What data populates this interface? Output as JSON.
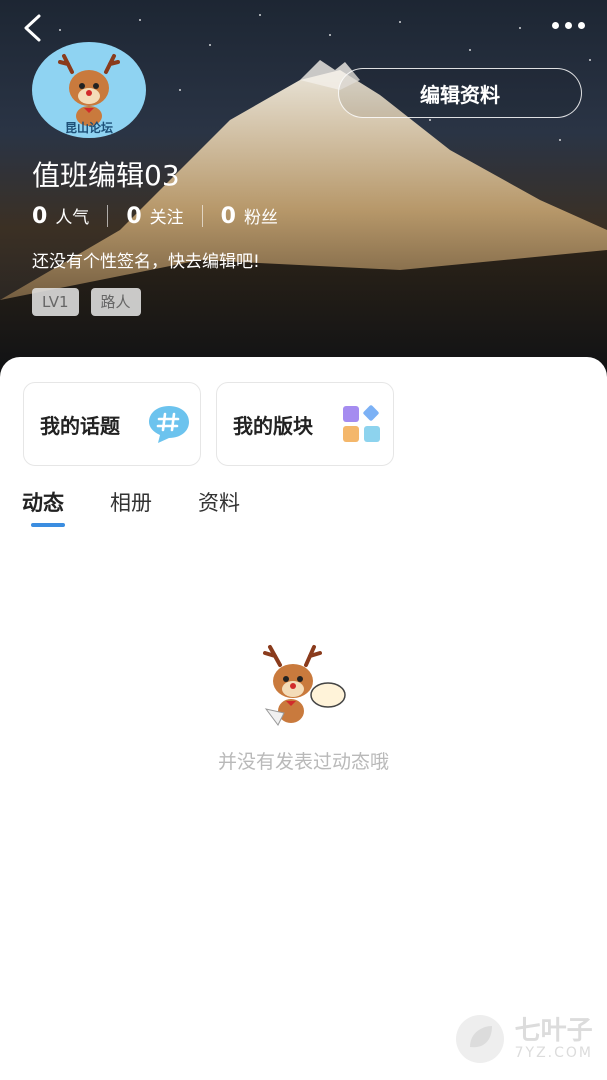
{
  "header": {
    "back_icon": "chevron-left-icon",
    "more_icon": "more-dots-icon"
  },
  "profile": {
    "avatar_caption": "昆山论坛",
    "edit_button_label": "编辑资料",
    "username": "值班编辑03",
    "stats": [
      {
        "value": "0",
        "label": "人气"
      },
      {
        "value": "0",
        "label": "关注"
      },
      {
        "value": "0",
        "label": "粉丝"
      }
    ],
    "signature": "还没有个性签名，快去编辑吧!",
    "tags": [
      "LV1",
      "路人"
    ]
  },
  "shortcuts": {
    "topics_label": "我的话题",
    "topics_icon": "hashtag-bubble-icon",
    "boards_label": "我的版块",
    "boards_icon": "grid-blocks-icon"
  },
  "tabs": [
    {
      "label": "动态",
      "active": true
    },
    {
      "label": "相册",
      "active": false
    },
    {
      "label": "资料",
      "active": false
    }
  ],
  "empty_state": {
    "message": "并没有发表过动态哦"
  },
  "watermark": {
    "name": "七叶子",
    "domain": "7YZ.COM"
  },
  "colors": {
    "accent": "#3b8de0",
    "empty_text": "#b9b9b9"
  }
}
